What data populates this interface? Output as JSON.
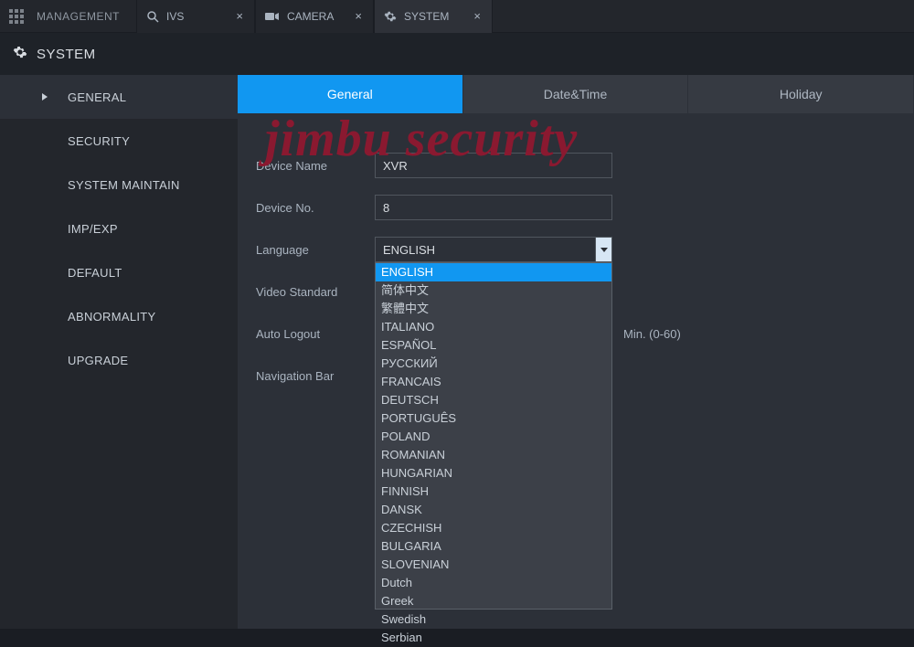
{
  "header": {
    "management": "MANAGEMENT",
    "tabs": [
      {
        "icon": "search",
        "label": "IVS"
      },
      {
        "icon": "camera",
        "label": "CAMERA"
      },
      {
        "icon": "gear",
        "label": "SYSTEM"
      }
    ]
  },
  "page_title": "SYSTEM",
  "sidebar": {
    "items": [
      {
        "label": "GENERAL",
        "active": true
      },
      {
        "label": "SECURITY"
      },
      {
        "label": "SYSTEM MAINTAIN"
      },
      {
        "label": "IMP/EXP"
      },
      {
        "label": "DEFAULT"
      },
      {
        "label": "ABNORMALITY"
      },
      {
        "label": "UPGRADE"
      }
    ]
  },
  "sub_tabs": [
    {
      "label": "General",
      "active": true
    },
    {
      "label": "Date&Time"
    },
    {
      "label": "Holiday"
    }
  ],
  "form": {
    "device_name_label": "Device Name",
    "device_name_value": "XVR",
    "device_no_label": "Device No.",
    "device_no_value": "8",
    "language_label": "Language",
    "language_value": "ENGLISH",
    "language_options": [
      "ENGLISH",
      "简体中文",
      "繁體中文",
      "ITALIANO",
      "ESPAÑOL",
      "РУССКИЙ",
      "FRANCAIS",
      "DEUTSCH",
      "PORTUGUÊS",
      "POLAND",
      "ROMANIAN",
      "HUNGARIAN",
      "FINNISH",
      "DANSK",
      "CZECHISH",
      "BULGARIA",
      "SLOVENIAN",
      "Dutch",
      "Greek",
      "Swedish",
      "Serbian"
    ],
    "video_standard_label": "Video Standard",
    "auto_logout_label": "Auto Logout",
    "auto_logout_hint": "Min. (0-60)",
    "nav_bar_label": "Navigation Bar"
  },
  "watermark": "jimbu security"
}
